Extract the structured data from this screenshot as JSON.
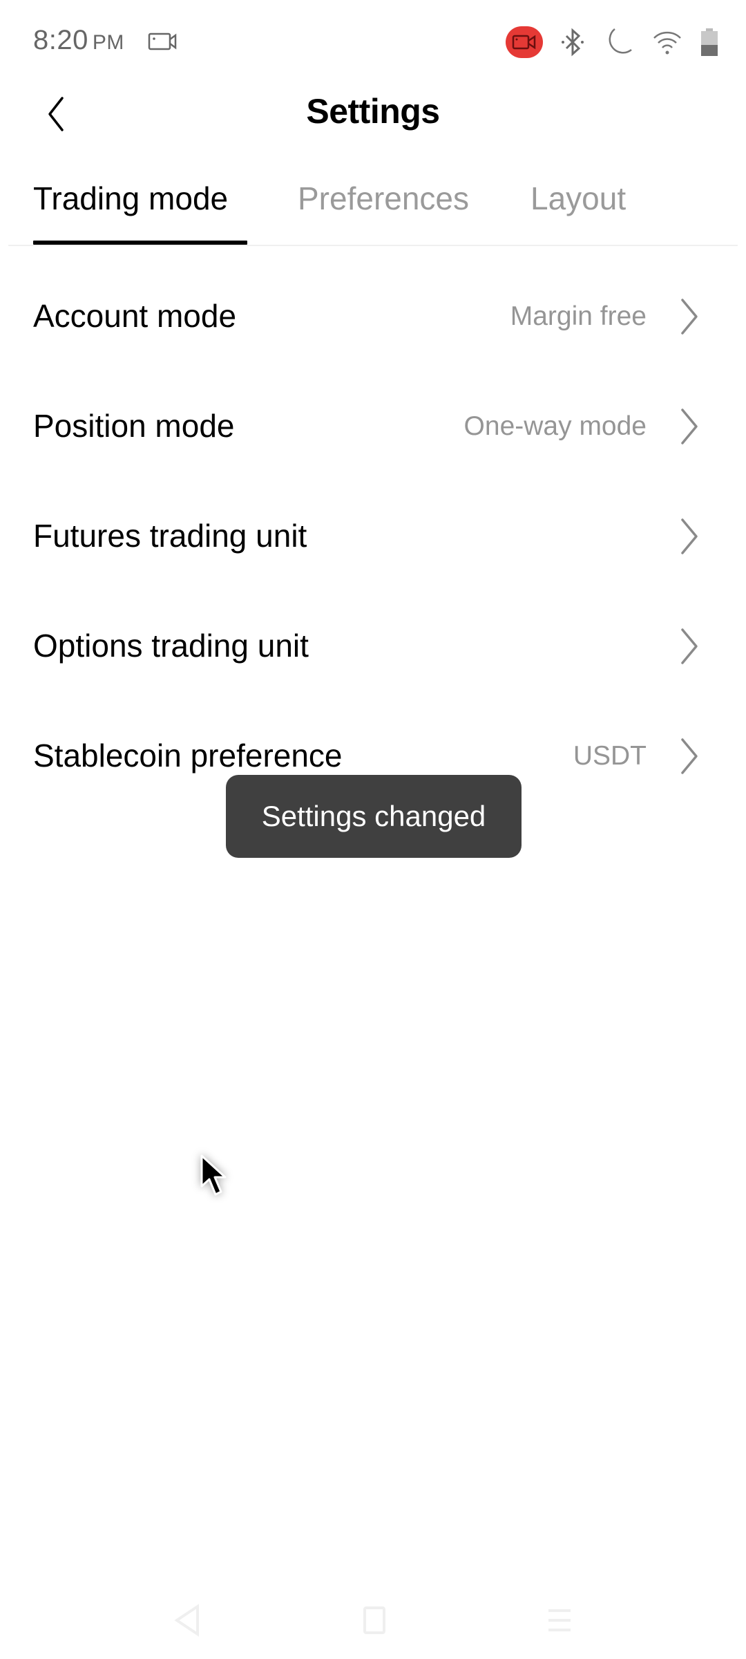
{
  "status_bar": {
    "time": "8:20",
    "ampm": "PM",
    "icons": [
      "screen-record-icon",
      "recording-indicator-icon",
      "bluetooth-icon",
      "do-not-disturb-moon-icon",
      "wifi-icon",
      "battery-icon"
    ]
  },
  "header": {
    "title": "Settings",
    "back_icon": "chevron-left-icon"
  },
  "tabs": [
    {
      "label": "Trading mode",
      "active": true
    },
    {
      "label": "Preferences",
      "active": false
    },
    {
      "label": "Layout",
      "active": false
    }
  ],
  "settings": [
    {
      "label": "Account mode",
      "value": "Margin free"
    },
    {
      "label": "Position mode",
      "value": "One-way mode"
    },
    {
      "label": "Futures trading unit",
      "value": ""
    },
    {
      "label": "Options trading unit",
      "value": ""
    },
    {
      "label": "Stablecoin preference",
      "value": "USDT"
    }
  ],
  "toast": {
    "message": "Settings changed"
  },
  "nav_bar": {
    "buttons": [
      "back",
      "home",
      "recents"
    ]
  },
  "colors": {
    "recording_red": "#e53935",
    "toast_bg": "#404040",
    "secondary_text": "#959595",
    "inactive_tab": "#9a9a9a"
  }
}
